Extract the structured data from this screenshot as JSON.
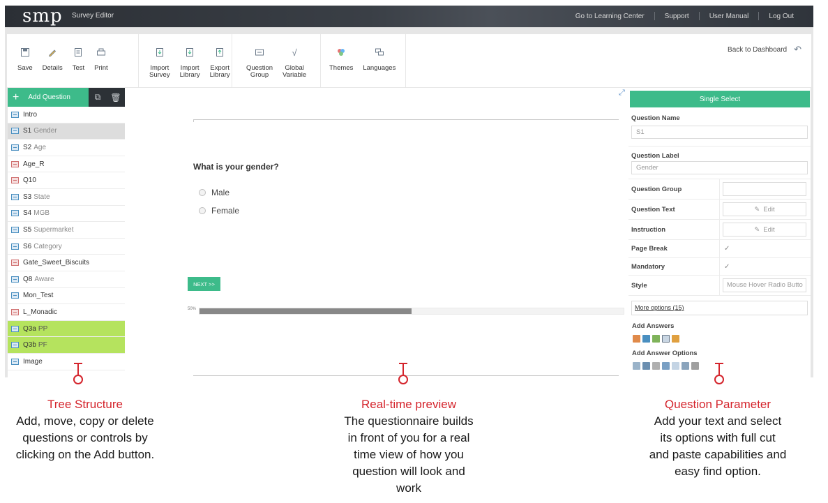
{
  "topbar": {
    "logo": "smp",
    "app_name": "Survey Editor",
    "links": [
      "Go to Learning Center",
      "Support",
      "User Manual",
      "Log Out"
    ]
  },
  "toolbar": {
    "group1": [
      {
        "label": "Save",
        "icon": "floppy-icon"
      },
      {
        "label": "Details",
        "icon": "pencil-icon"
      },
      {
        "label": "Test",
        "icon": "document-icon"
      },
      {
        "label": "Print",
        "icon": "printer-icon"
      }
    ],
    "group2": [
      {
        "label": "Import\nSurvey",
        "icon": "import-survey-icon"
      },
      {
        "label": "Import\nLibrary",
        "icon": "import-library-icon"
      },
      {
        "label": "Export\nLibrary",
        "icon": "export-library-icon"
      }
    ],
    "group3": [
      {
        "label": "Question\nGroup",
        "icon": "question-group-icon"
      },
      {
        "label": "Global\nVariable",
        "icon": "sqrt-icon"
      }
    ],
    "group4": [
      {
        "label": "Themes",
        "icon": "palette-icon"
      },
      {
        "label": "Languages",
        "icon": "languages-icon"
      }
    ],
    "back_label": "Back to Dashboard"
  },
  "tree": {
    "add_label": "Add Question",
    "items": [
      {
        "code": "Intro",
        "sub": "",
        "state": "normal"
      },
      {
        "code": "S1",
        "sub": "Gender",
        "state": "selected"
      },
      {
        "code": "S2",
        "sub": "Age",
        "state": "normal"
      },
      {
        "code": "Age_R",
        "sub": "",
        "state": "normal"
      },
      {
        "code": "Q10",
        "sub": "",
        "state": "normal"
      },
      {
        "code": "S3",
        "sub": "State",
        "state": "normal"
      },
      {
        "code": "S4",
        "sub": "MGB",
        "state": "normal"
      },
      {
        "code": "S5",
        "sub": "Supermarket",
        "state": "normal"
      },
      {
        "code": "S6",
        "sub": "Category",
        "state": "normal"
      },
      {
        "code": "Gate_Sweet_Biscuits",
        "sub": "",
        "state": "normal"
      },
      {
        "code": "Q8",
        "sub": "Aware",
        "state": "normal"
      },
      {
        "code": "Mon_Test",
        "sub": "",
        "state": "normal"
      },
      {
        "code": "L_Monadic",
        "sub": "",
        "state": "normal"
      },
      {
        "code": "Q3a",
        "sub": "PP",
        "state": "green"
      },
      {
        "code": "Q3b",
        "sub": "PF",
        "state": "green"
      },
      {
        "code": "Image",
        "sub": "",
        "state": "normal"
      }
    ]
  },
  "preview": {
    "question": "What is your gender?",
    "options": [
      "Male",
      "Female"
    ],
    "next_label": "NEXT >>",
    "progress_label": "50%",
    "progress": 0.5
  },
  "params": {
    "header": "Single Select",
    "question_name_label": "Question Name",
    "question_name_value": "S1",
    "question_label_label": "Question Label",
    "question_label_value": "Gender",
    "rows": {
      "group": "Question Group",
      "text": "Question Text",
      "instruction": "Instruction",
      "page_break": "Page Break",
      "mandatory": "Mandatory",
      "style": "Style"
    },
    "edit_label": "Edit",
    "style_value": "Mouse Hover Radio Butto",
    "more_options": "More options (15)",
    "add_answers": "Add Answers",
    "add_answer_options": "Add Answer Options"
  },
  "callouts": [
    {
      "title": "Tree Structure",
      "body": "Add, move, copy or delete\nquestions or controls by\nclicking on the Add button."
    },
    {
      "title": "Real-time preview",
      "body": "The questionnaire builds\nin front of you for a real\ntime view of how you\nquestion will look and\nwork"
    },
    {
      "title": "Question Parameter",
      "body": "Add your text and select\nits options with full cut\nand paste capabilities and\neasy find option."
    }
  ]
}
